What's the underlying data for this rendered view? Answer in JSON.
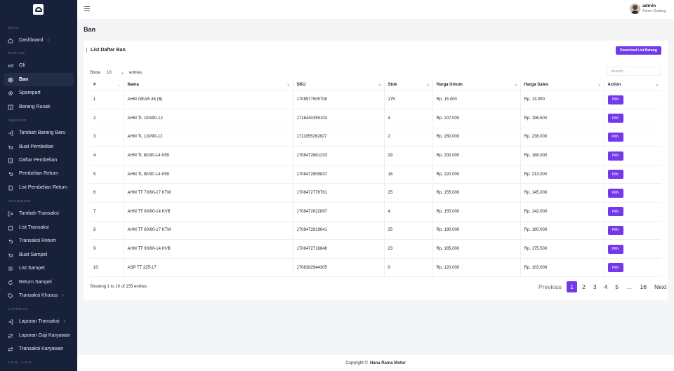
{
  "sidebar": {
    "sections": {
      "main": "MAIN",
      "barang": "BARANG",
      "inbound": "INBOUND",
      "outbound": "OUTBOUND",
      "laporan": "LAPORAN",
      "lain": "LAIN - LAIN"
    },
    "items": [
      {
        "label": "Dashboard",
        "icon": "home-icon"
      },
      {
        "label": "Oli",
        "icon": "oil-can-icon"
      },
      {
        "label": "Ban",
        "icon": "tire-icon"
      },
      {
        "label": "Sparepart",
        "icon": "gear-icon"
      },
      {
        "label": "Barang Rusak",
        "icon": "broken-box-icon"
      },
      {
        "label": "Tambah Barang Baru",
        "icon": "login-arrow-icon"
      },
      {
        "label": "Buat Pembelian",
        "icon": "cart-icon"
      },
      {
        "label": "Daftar Pembelian",
        "icon": "list-icon"
      },
      {
        "label": "Pembelian Return",
        "icon": "undo-icon"
      },
      {
        "label": "List Pembelian Return",
        "icon": "document-icon"
      },
      {
        "label": "Tambah Transaksi",
        "icon": "logout-arrow-icon"
      },
      {
        "label": "List Transaksi",
        "icon": "clipboard-icon"
      },
      {
        "label": "Transaksi Return",
        "icon": "undo-icon"
      },
      {
        "label": "Buat Sampel",
        "icon": "cart-icon"
      },
      {
        "label": "List Sampel",
        "icon": "bullet-list-icon"
      },
      {
        "label": "Return Sampel",
        "icon": "refresh-icon"
      },
      {
        "label": "Transaksi Khusus",
        "icon": "tag-icon"
      },
      {
        "label": "Laporan Transaksi",
        "icon": "login-arrow-icon"
      },
      {
        "label": "Laporan Gaji Karyawan",
        "icon": "swap-icon"
      },
      {
        "label": "Transaksi Karyawan",
        "icon": "swap-icon"
      }
    ]
  },
  "header": {
    "user_name": "admin",
    "user_role": "Admin Gudang"
  },
  "page": {
    "title": "Ban"
  },
  "card": {
    "title": "List Daftar Ban",
    "download_label": "Download List Barang"
  },
  "table_controls": {
    "show_label": "Show",
    "entries_value": "10",
    "entries_label": "entries",
    "search_placeholder": "Search..."
  },
  "table": {
    "columns": [
      "#",
      "Nama",
      "SKU",
      "Stok",
      "Harga Umum",
      "Harga Sales",
      "Action"
    ],
    "action_label": "Pilih",
    "rows": [
      [
        "1",
        "AHM GEAR 48 (B)",
        "1708577905708",
        "175",
        "Rp. 15.000",
        "Rp. 13.000"
      ],
      [
        "2",
        "AHM TL 100/90-12",
        "1716440359103",
        "4",
        "Rp. 207.000",
        "Rp. 196.500"
      ],
      [
        "3",
        "AHM TL 110/90-12",
        "1711955262827",
        "2",
        "Rp. 260.000",
        "Rp. 238.000"
      ],
      [
        "4",
        "AHM TL 80/90-14 K59",
        "1708472861233",
        "29",
        "Rp. 200.000",
        "Rp. 188.000"
      ],
      [
        "5",
        "AHM TL 90/90-14 K59",
        "1708472909837",
        "16",
        "Rp. 220.000",
        "Rp. 213.000"
      ],
      [
        "6",
        "AHM TT 70/90-17 KTM",
        "1708472776761",
        "25",
        "Rp. 155.000",
        "Rp. 145.000"
      ],
      [
        "7",
        "AHM TT 80/90-14 KVB",
        "1708472622897",
        "4",
        "Rp. 155.000",
        "Rp. 142.000"
      ],
      [
        "8",
        "AHM TT 80/90-17 KTM",
        "1708472819641",
        "25",
        "Rp. 190.000",
        "Rp. 180.000"
      ],
      [
        "9",
        "AHM TT 90/90-14 KVB",
        "1708472716848",
        "23",
        "Rp. 185.000",
        "Rp. 175.500"
      ],
      [
        "10",
        "ASP TT 225-17",
        "1708382944305",
        "0",
        "Rp. 120.000",
        "Rp. 103.000"
      ]
    ]
  },
  "pagination": {
    "info": "Showing 1 to 10 of 155 entries",
    "previous": "Previous",
    "pages": [
      "1",
      "2",
      "3",
      "4",
      "5",
      "…",
      "16"
    ],
    "next": "Next"
  },
  "footer": {
    "copyright": "Copyright ©",
    "company": "Hana Rama Motor"
  },
  "colors": {
    "sidebar_bg": "#17213a",
    "accent": "#7239ea",
    "background": "#f4f5f7"
  }
}
